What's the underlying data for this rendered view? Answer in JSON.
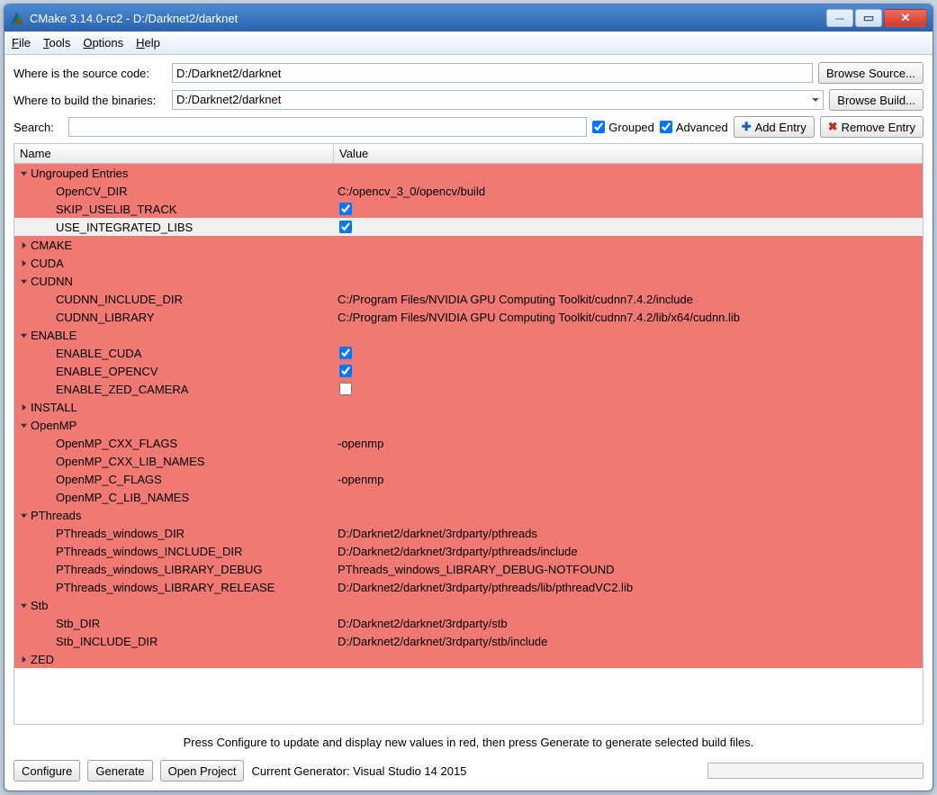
{
  "window_title": "CMake 3.14.0-rc2 - D:/Darknet2/darknet",
  "menu": {
    "file": "File",
    "tools": "Tools",
    "options": "Options",
    "help": "Help"
  },
  "source_label": "Where is the source code:",
  "source_path": "D:/Darknet2/darknet",
  "browse_source": "Browse Source...",
  "build_label": "Where to build the binaries:",
  "build_path": "D:/Darknet2/darknet",
  "browse_build": "Browse Build...",
  "search_label": "Search:",
  "search_value": "",
  "grouped_label": "Grouped",
  "grouped": true,
  "advanced_label": "Advanced",
  "advanced": true,
  "add_entry": "Add Entry",
  "remove_entry": "Remove Entry",
  "col_name": "Name",
  "col_value": "Value",
  "footer_msg": "Press Configure to update and display new values in red, then press Generate to generate selected build files.",
  "configure": "Configure",
  "generate": "Generate",
  "open_project": "Open Project",
  "generator_label": "Current Generator: Visual Studio 14 2015",
  "tree": [
    {
      "type": "group",
      "expanded": true,
      "name": "Ungrouped Entries",
      "items": [
        {
          "name": "OpenCV_DIR",
          "value": "C:/opencv_3_0/opencv/build"
        },
        {
          "name": "SKIP_USELIB_TRACK",
          "checkbox": true,
          "checked": true
        },
        {
          "name": "USE_INTEGRATED_LIBS",
          "checkbox": true,
          "checked": true,
          "plain": true
        }
      ]
    },
    {
      "type": "group",
      "expanded": false,
      "name": "CMAKE"
    },
    {
      "type": "group",
      "expanded": false,
      "name": "CUDA"
    },
    {
      "type": "group",
      "expanded": true,
      "name": "CUDNN",
      "items": [
        {
          "name": "CUDNN_INCLUDE_DIR",
          "value": "C:/Program Files/NVIDIA GPU Computing Toolkit/cudnn7.4.2/include"
        },
        {
          "name": "CUDNN_LIBRARY",
          "value": "C:/Program Files/NVIDIA GPU Computing Toolkit/cudnn7.4.2/lib/x64/cudnn.lib"
        }
      ]
    },
    {
      "type": "group",
      "expanded": true,
      "name": "ENABLE",
      "items": [
        {
          "name": "ENABLE_CUDA",
          "checkbox": true,
          "checked": true
        },
        {
          "name": "ENABLE_OPENCV",
          "checkbox": true,
          "checked": true
        },
        {
          "name": "ENABLE_ZED_CAMERA",
          "checkbox": true,
          "checked": false
        }
      ]
    },
    {
      "type": "group",
      "expanded": false,
      "name": "INSTALL"
    },
    {
      "type": "group",
      "expanded": true,
      "name": "OpenMP",
      "items": [
        {
          "name": "OpenMP_CXX_FLAGS",
          "value": "-openmp"
        },
        {
          "name": "OpenMP_CXX_LIB_NAMES",
          "value": ""
        },
        {
          "name": "OpenMP_C_FLAGS",
          "value": "-openmp"
        },
        {
          "name": "OpenMP_C_LIB_NAMES",
          "value": ""
        }
      ]
    },
    {
      "type": "group",
      "expanded": true,
      "name": "PThreads",
      "items": [
        {
          "name": "PThreads_windows_DIR",
          "value": "D:/Darknet2/darknet/3rdparty/pthreads"
        },
        {
          "name": "PThreads_windows_INCLUDE_DIR",
          "value": "D:/Darknet2/darknet/3rdparty/pthreads/include"
        },
        {
          "name": "PThreads_windows_LIBRARY_DEBUG",
          "value": "PThreads_windows_LIBRARY_DEBUG-NOTFOUND"
        },
        {
          "name": "PThreads_windows_LIBRARY_RELEASE",
          "value": "D:/Darknet2/darknet/3rdparty/pthreads/lib/pthreadVC2.lib"
        }
      ]
    },
    {
      "type": "group",
      "expanded": true,
      "name": "Stb",
      "items": [
        {
          "name": "Stb_DIR",
          "value": "D:/Darknet2/darknet/3rdparty/stb"
        },
        {
          "name": "Stb_INCLUDE_DIR",
          "value": "D:/Darknet2/darknet/3rdparty/stb/include"
        }
      ]
    },
    {
      "type": "group",
      "expanded": false,
      "name": "ZED"
    }
  ]
}
